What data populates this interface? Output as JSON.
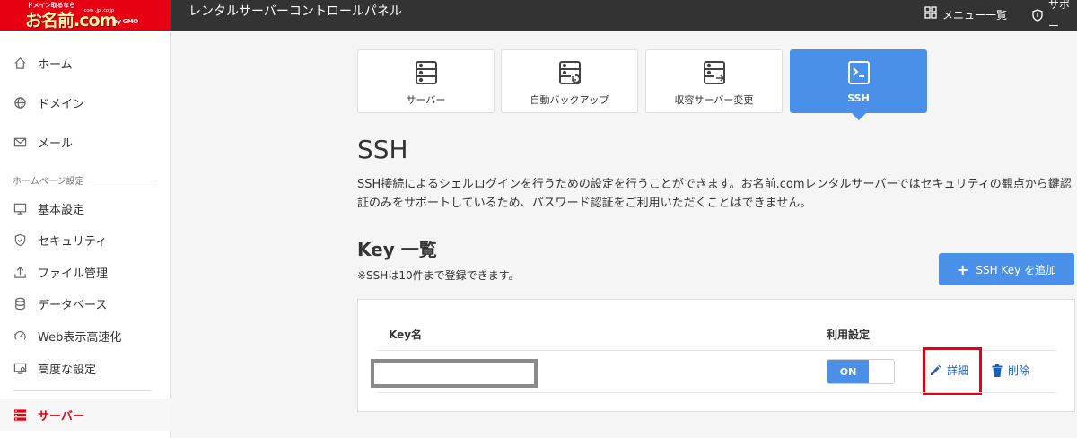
{
  "brand": {
    "tagline": "ドメイン取るなら",
    "name": "お名前.com",
    "domain_ext": ".com .jp .co.jp",
    "company": "by GMO"
  },
  "header": {
    "title": "レンタルサーバーコントロールパネル",
    "menu_label": "メニュー一覧",
    "support_label": "サポー"
  },
  "sidebar": {
    "items": [
      {
        "label": "ホーム",
        "icon": "home-icon"
      },
      {
        "label": "ドメイン",
        "icon": "globe-icon"
      },
      {
        "label": "メール",
        "icon": "mail-icon"
      }
    ],
    "section_label": "ホームページ設定",
    "settings_items": [
      {
        "label": "基本設定",
        "icon": "monitor-icon"
      },
      {
        "label": "セキュリティ",
        "icon": "shield-icon"
      },
      {
        "label": "ファイル管理",
        "icon": "upload-icon"
      },
      {
        "label": "データベース",
        "icon": "database-icon"
      },
      {
        "label": "Web表示高速化",
        "icon": "speed-icon"
      },
      {
        "label": "高度な設定",
        "icon": "advanced-icon"
      }
    ],
    "server_item": {
      "label": "サーバー",
      "icon": "server-icon"
    }
  },
  "tabs": [
    {
      "label": "サーバー",
      "icon": "server-icon"
    },
    {
      "label": "自動バックアップ",
      "icon": "backup-icon"
    },
    {
      "label": "収容サーバー変更",
      "icon": "server-transfer-icon"
    },
    {
      "label": "SSH",
      "icon": "terminal-icon"
    }
  ],
  "active_tab": "SSH",
  "main": {
    "title": "SSH",
    "description": "SSH接続によるシェルログインを行うための設定を行うことができます。お名前.comレンタルサーバーではセキュリティの観点から鍵認証のみをサポートしているため、パスワード認証をご利用いただくことはできません。",
    "key_list_title": "Key 一覧",
    "note": "※SSHは10件まで登録できます。",
    "add_button": "SSH Key を追加"
  },
  "key_table": {
    "col_name": "Key名",
    "col_status": "利用設定",
    "rows": [
      {
        "name": "",
        "status": "ON",
        "detail_label": "詳細",
        "delete_label": "削除"
      }
    ]
  },
  "colors": {
    "accent": "#4a8fe8",
    "brand_red": "#e60012",
    "header_bg": "#333333",
    "link": "#1a5fb4",
    "highlight": "#e60012"
  }
}
